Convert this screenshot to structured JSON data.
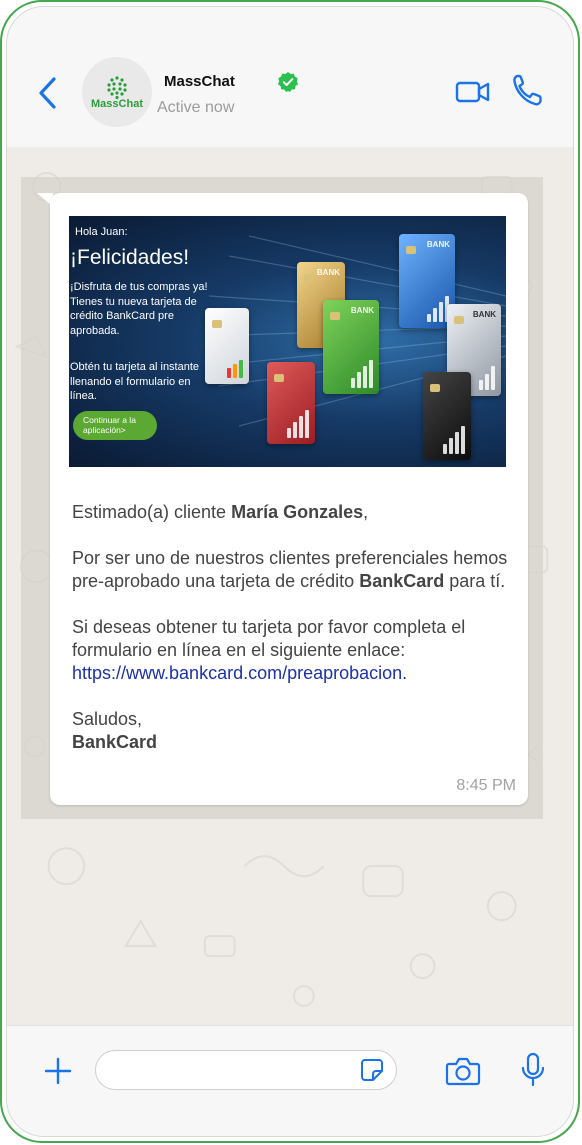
{
  "header": {
    "contact_name": "MassChat",
    "status": "Active now",
    "avatar_logo_text": "MassChat",
    "back_icon": "chevron-left-icon",
    "verified_icon": "verified-check-icon",
    "video_icon": "video-call-icon",
    "call_icon": "phone-icon"
  },
  "message": {
    "banner": {
      "greeting": "Hola Juan:",
      "headline": "¡Felicidades!",
      "body": "¡Disfruta de tus compras ya! Tienes tu nueva tarjeta de crédito BankCard pre aprobada.",
      "body2": "Obtén tu tarjeta al instante llenando el formulario en línea.",
      "button": "Continuar a la aplicación>",
      "card_brand": "BANK"
    },
    "greeting_prefix": "Estimado(a) cliente ",
    "customer_name": "María Gonzales",
    "greeting_suffix": ",",
    "p2_text": "Por ser uno de nuestros clientes preferenciales hemos pre-aprobado una tarjeta de crédito ",
    "p2_brand": "BankCard",
    "p2_suffix": " para tí.",
    "p3_text": "Si deseas obtener tu tarjeta por favor completa el formulario en línea en el siguiente enlace: ",
    "link": "https://www.bankcard.com/preaprobacion.",
    "closing": "Saludos,",
    "signature": "BankCard",
    "time": "8:45 PM"
  },
  "composer": {
    "input_value": "",
    "add_icon": "plus-icon",
    "sticker_icon": "sticker-icon",
    "camera_icon": "camera-icon",
    "mic_icon": "microphone-icon"
  },
  "colors": {
    "accent_blue": "#1a73e8",
    "verified_green": "#2bbf4e",
    "frame_green": "#45a74e",
    "link_blue": "#1b32a8"
  }
}
